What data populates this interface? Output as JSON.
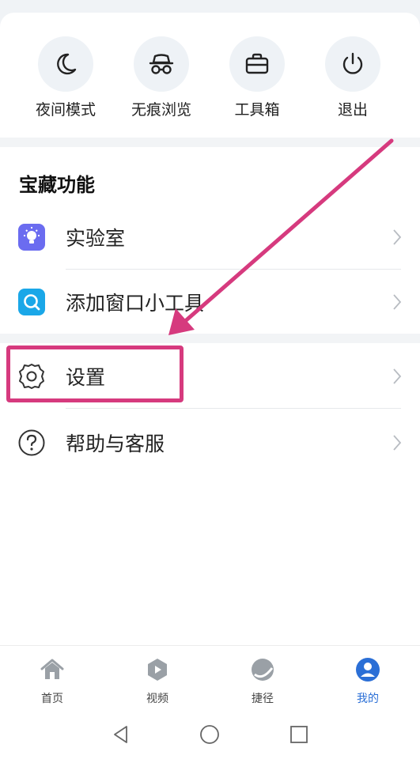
{
  "quick_actions": [
    {
      "label": "夜间模式",
      "icon": "moon-icon"
    },
    {
      "label": "无痕浏览",
      "icon": "incognito-icon"
    },
    {
      "label": "工具箱",
      "icon": "toolbox-icon"
    },
    {
      "label": "退出",
      "icon": "power-icon"
    }
  ],
  "section": {
    "title": "宝藏功能"
  },
  "menu": [
    {
      "label": "实验室",
      "icon": "lab-bulb-icon"
    },
    {
      "label": "添加窗口小工具",
      "icon": "widget-search-icon"
    },
    {
      "label": "设置",
      "icon": "gear-icon"
    },
    {
      "label": "帮助与客服",
      "icon": "help-icon"
    }
  ],
  "bottom_nav": [
    {
      "label": "首页",
      "icon": "home-icon",
      "active": false
    },
    {
      "label": "视频",
      "icon": "video-icon",
      "active": false
    },
    {
      "label": "捷径",
      "icon": "shortcut-icon",
      "active": false
    },
    {
      "label": "我的",
      "icon": "profile-icon",
      "active": true
    }
  ],
  "colors": {
    "accent": "#2b6fd6",
    "annotation": "#d63a7e",
    "lab_icon": "#6b6cf0",
    "widget_icon": "#1aa7e8"
  }
}
